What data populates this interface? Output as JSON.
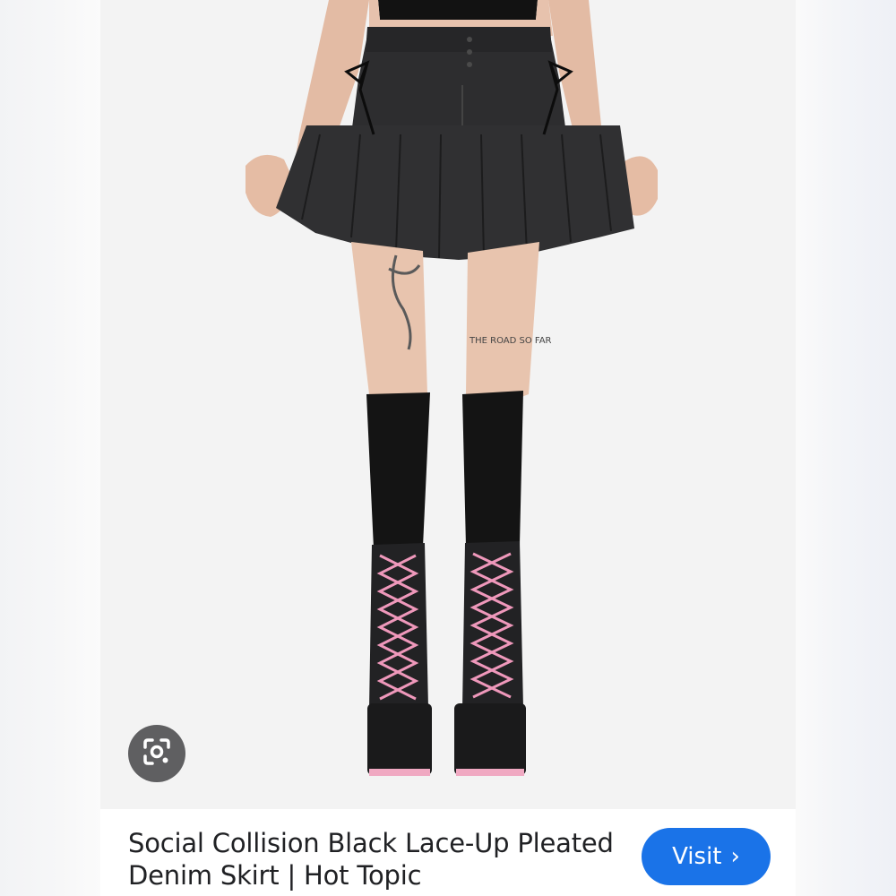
{
  "result": {
    "title": "Social Collision Black Lace-Up Pleated Denim Skirt | Hot Topic",
    "visit_label": "Visit",
    "visit_chevron": "›",
    "tattoo_text": "THE ROAD SO FAR"
  },
  "icons": {
    "lens": "google-lens-icon",
    "visit": "chevron-right-icon"
  },
  "colors": {
    "visit_button": "#1a73e8",
    "lens_button": "#5f5f61",
    "title_text": "#202124"
  }
}
